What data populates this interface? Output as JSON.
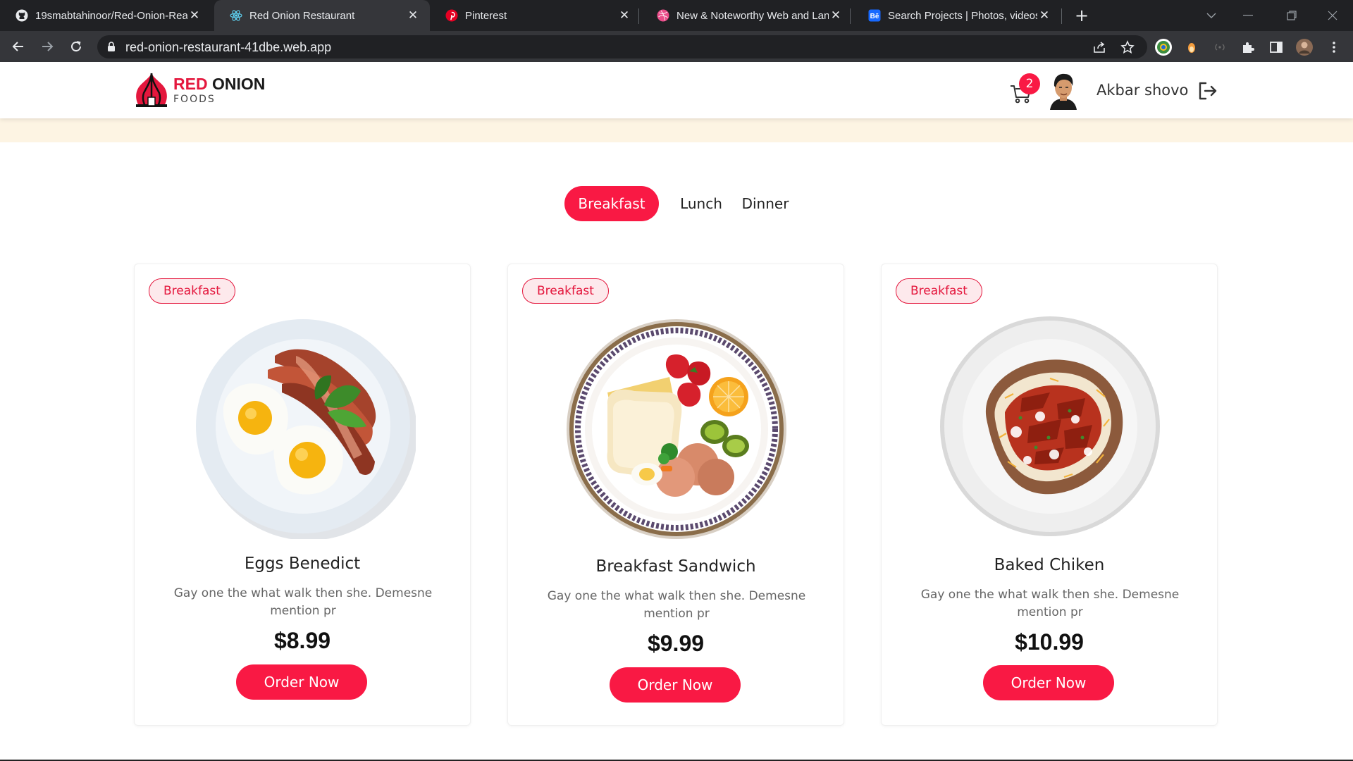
{
  "browser": {
    "tabs": [
      {
        "title": "19smabtahinoor/Red-Onion-Rea",
        "favicon": "github-icon"
      },
      {
        "title": "Red Onion Restaurant",
        "favicon": "react-icon",
        "active": true
      },
      {
        "title": "Pinterest",
        "favicon": "pinterest-icon"
      },
      {
        "title": "New & Noteworthy Web and Lan",
        "favicon": "dribbble-icon"
      },
      {
        "title": "Search Projects | Photos, videos, l",
        "favicon": "behance-icon"
      }
    ],
    "url": "red-onion-restaurant-41dbe.web.app"
  },
  "header": {
    "logo_primary": "RED",
    "logo_secondary": "ONION",
    "logo_sub": "FOODS",
    "cart_count": "2",
    "user_name": "Akbar shovo"
  },
  "filters": {
    "items": [
      "Breakfast",
      "Lunch",
      "Dinner"
    ],
    "active": "Breakfast"
  },
  "cards": [
    {
      "tag": "Breakfast",
      "name": "Eggs Benedict",
      "desc": "Gay one the what walk then she. Demesne mention pr",
      "price": "$8.99",
      "button": "Order Now"
    },
    {
      "tag": "Breakfast",
      "name": "Breakfast Sandwich",
      "desc": "Gay one the what walk then she. Demesne mention pr",
      "price": "$9.99",
      "button": "Order Now"
    },
    {
      "tag": "Breakfast",
      "name": "Baked Chiken",
      "desc": "Gay one the what walk then she. Demesne mention pr",
      "price": "$10.99",
      "button": "Order Now"
    }
  ],
  "colors": {
    "brand": "#f91944",
    "brand_dark": "#e4173d",
    "banner": "#fdf4e3"
  }
}
